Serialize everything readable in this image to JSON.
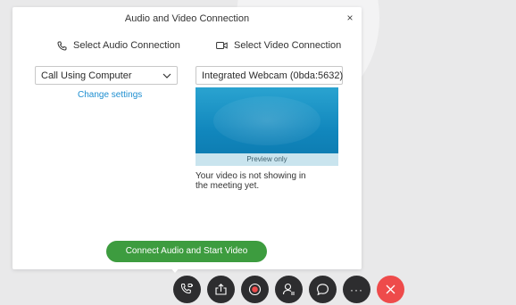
{
  "dialog": {
    "title": "Audio and Video Connection",
    "close_label": "×"
  },
  "audio": {
    "heading": "Select Audio Connection",
    "selected": "Call Using Computer",
    "change_settings": "Change settings"
  },
  "video": {
    "heading": "Select Video Connection",
    "selected": "Integrated Webcam (0bda:5632)",
    "preview_caption": "Preview only",
    "note": "Your video is not showing in the meeting yet."
  },
  "connect_button": "Connect Audio and Start Video",
  "controls": [
    {
      "name": "audio-connection-button",
      "icon": "phone-video-icon"
    },
    {
      "name": "share-button",
      "icon": "share-icon"
    },
    {
      "name": "record-button",
      "icon": "record-icon"
    },
    {
      "name": "participants-button",
      "icon": "participants-icon"
    },
    {
      "name": "chat-button",
      "icon": "chat-icon"
    },
    {
      "name": "more-options-button",
      "icon": "more-icon",
      "label": "···"
    },
    {
      "name": "leave-meeting-button",
      "icon": "close-icon"
    }
  ],
  "colors": {
    "accent_green": "#3d9c3f",
    "link_blue": "#1d8ed0",
    "leave_red": "#ee4b4b",
    "control_dark": "#2d2d2f"
  }
}
